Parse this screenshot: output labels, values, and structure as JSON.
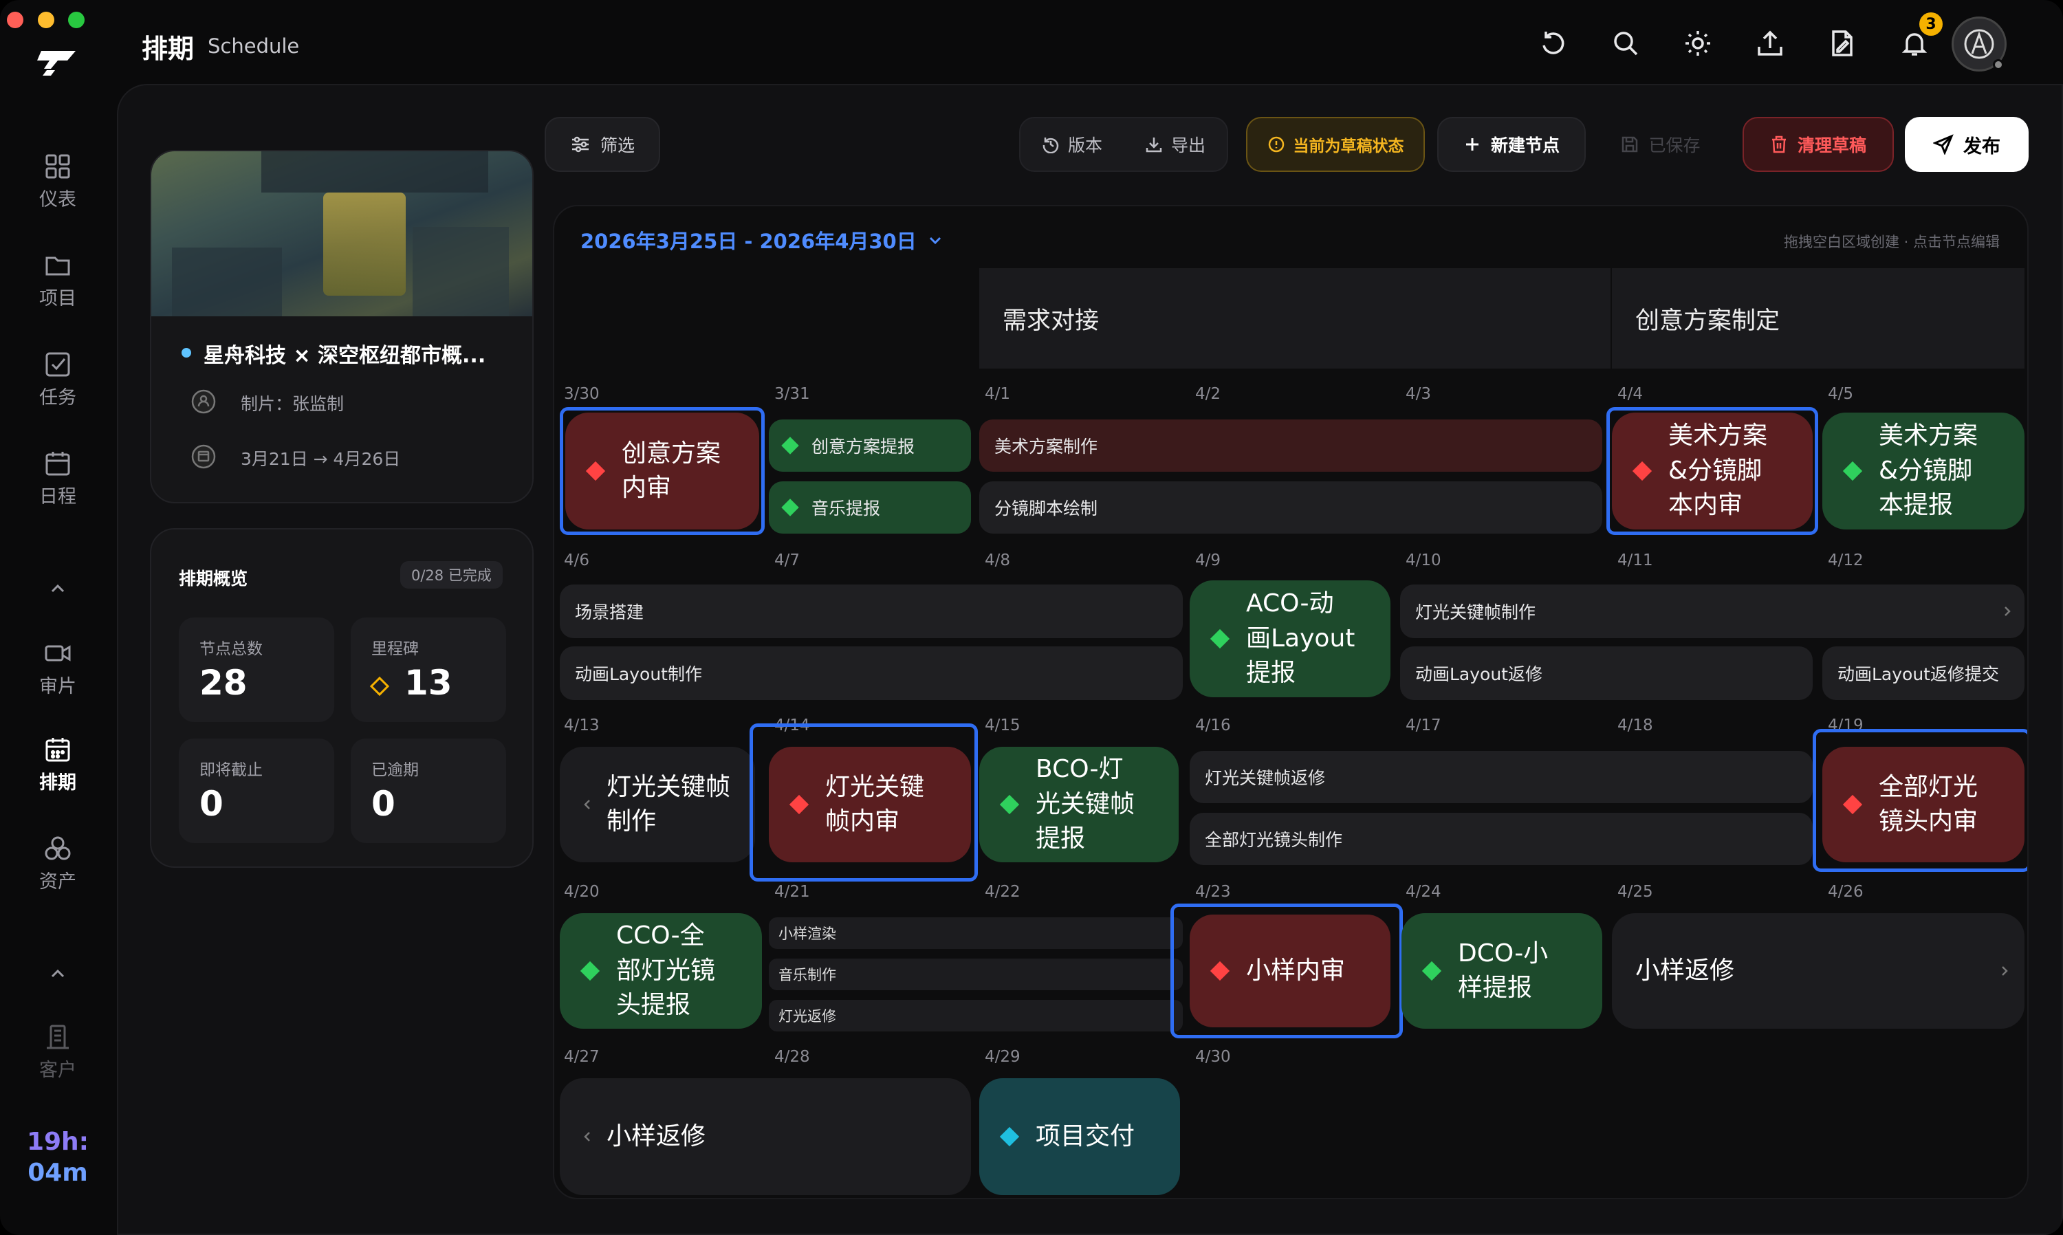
{
  "window": {
    "title_cn": "排期",
    "title_en": "Schedule"
  },
  "sidebar": {
    "items": [
      {
        "label": "仪表",
        "icon": "dashboard-icon"
      },
      {
        "label": "项目",
        "icon": "folder-icon"
      },
      {
        "label": "任务",
        "icon": "task-check-icon"
      },
      {
        "label": "日程",
        "icon": "calendar-icon"
      },
      {
        "label": "审片",
        "icon": "video-camera-icon"
      },
      {
        "label": "排期",
        "icon": "schedule-icon"
      },
      {
        "label": "资产",
        "icon": "assets-icon"
      },
      {
        "label": "客户",
        "icon": "client-building-icon"
      }
    ],
    "timer_line1": "19h:",
    "timer_line2": "04m"
  },
  "header": {
    "notification_count": "3"
  },
  "project": {
    "name": "星舟科技 × 深空枢纽都市概...",
    "producer_label": "制片：张监制",
    "date_range": "3月21日 → 4月26日"
  },
  "overview": {
    "title": "排期概览",
    "progress": "0/28 已完成",
    "stats": [
      {
        "label": "节点总数",
        "value": "28"
      },
      {
        "label": "里程碑",
        "value": "13"
      },
      {
        "label": "即将截止",
        "value": "0"
      },
      {
        "label": "已逾期",
        "value": "0"
      }
    ]
  },
  "toolbar": {
    "filter": "筛选",
    "version": "版本",
    "export": "导出",
    "draft_status": "当前为草稿状态",
    "new_node": "新建节点",
    "saved": "已保存",
    "clear_draft": "清理草稿",
    "publish": "发布"
  },
  "schedule": {
    "range": "2026年3月25日 - 2026年4月30日",
    "hint": "拖拽空白区域创建 · 点击节点编辑",
    "phase1": "需求对接",
    "phase2": "创意方案制定",
    "dates": [
      "3/30",
      "3/31",
      "4/1",
      "4/2",
      "4/3",
      "4/4",
      "4/5",
      "4/6",
      "4/7",
      "4/8",
      "4/9",
      "4/10",
      "4/11",
      "4/12",
      "4/13",
      "4/14",
      "4/15",
      "4/16",
      "4/17",
      "4/18",
      "4/19",
      "4/20",
      "4/21",
      "4/22",
      "4/23",
      "4/24",
      "4/25",
      "4/26",
      "4/27",
      "4/28",
      "4/29",
      "4/30"
    ],
    "labels": {
      "n1": "创意方案\n内审",
      "b1": "创意方案提报",
      "b2": "音乐提报",
      "b3": "美术方案制作",
      "b4": "分镜脚本绘制",
      "n2": "美术方案\n&分镜脚\n本内审",
      "n3": "美术方案\n&分镜脚\n本提报",
      "b5": "场景搭建",
      "b6": "动画Layout制作",
      "n4": "ACO-动\n画Layout\n提报",
      "b7": "灯光关键帧制作",
      "b8": "动画Layout返修",
      "b9": "动画Layout返修提交",
      "n5": "灯光关键帧\n制作",
      "n6": "灯光关键\n帧内审",
      "n7": "BCO-灯\n光关键帧\n提报",
      "b10": "灯光关键帧返修",
      "b11": "全部灯光镜头制作",
      "n8": "全部灯光\n镜头内审",
      "n9": "CCO-全\n部灯光镜\n头提报",
      "s1": "小样渲染",
      "s2": "音乐制作",
      "s3": "灯光返修",
      "n10": "小样内审",
      "n11": "DCO-小\n样提报",
      "n12": "小样返修",
      "n13": "小样返修",
      "n14": "项目交付"
    }
  }
}
